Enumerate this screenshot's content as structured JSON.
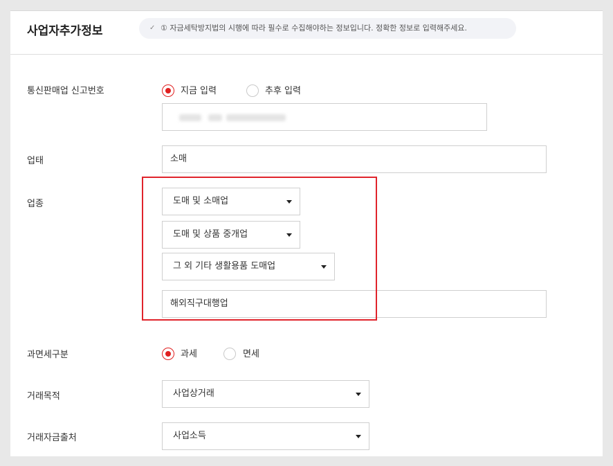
{
  "header": {
    "title": "사업자추가정보",
    "notice": "① 자금세탁방지법의 시행에 따라 필수로 수집해야하는 정보입니다. 정확한 정보로 입력해주세요."
  },
  "form": {
    "mail_order": {
      "label": "통신판매업 신고번호",
      "option_now": "지금 입력",
      "option_later": "추후 입력",
      "selected": "지금 입력"
    },
    "business_type": {
      "label": "업태",
      "value": "소매"
    },
    "business_item": {
      "label": "업종",
      "select1": "도매 및 소매업",
      "select2": "도매 및 상품 중개업",
      "select3": "그 외 기타 생활용품 도매업",
      "detail": "해외직구대행업"
    },
    "tax": {
      "label": "과면세구분",
      "option_taxable": "과세",
      "option_exempt": "면세",
      "selected": "과세"
    },
    "purpose": {
      "label": "거래목적",
      "value": "사업상거래"
    },
    "fund_source": {
      "label": "거래자금출처",
      "value": "사업소득"
    }
  },
  "colors": {
    "accent": "#e02020",
    "highlight_box": "#e0232b",
    "notice_bg": "#f2f3f7"
  }
}
